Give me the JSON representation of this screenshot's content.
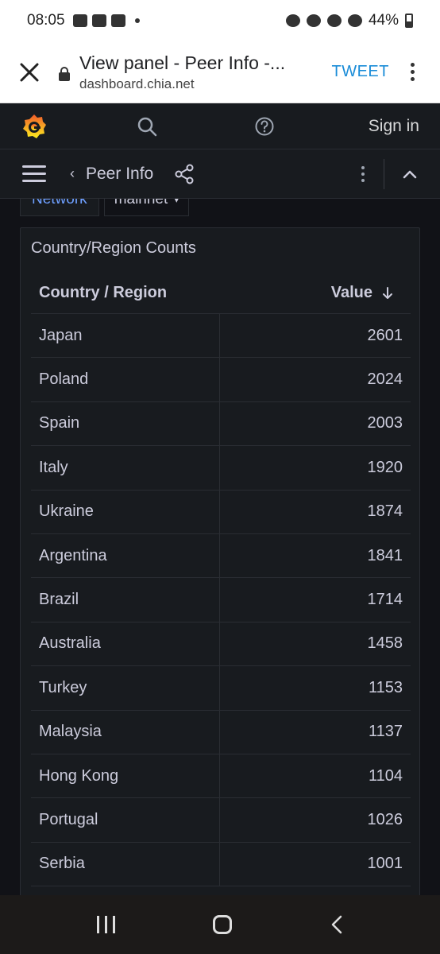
{
  "status_bar": {
    "time": "08:05",
    "battery": "44%"
  },
  "browser": {
    "page_title": "View panel - Peer Info -...",
    "url": "dashboard.chia.net",
    "tweet_label": "TWEET"
  },
  "grafana": {
    "sign_in_label": "Sign in",
    "dashboard_title": "Peer Info",
    "variable": {
      "label": "Network",
      "value": "mainnet"
    }
  },
  "panel": {
    "title": "Country/Region Counts",
    "columns": [
      "Country / Region",
      "Value"
    ],
    "rows": [
      {
        "country": "Japan",
        "value": "2601"
      },
      {
        "country": "Poland",
        "value": "2024"
      },
      {
        "country": "Spain",
        "value": "2003"
      },
      {
        "country": "Italy",
        "value": "1920"
      },
      {
        "country": "Ukraine",
        "value": "1874"
      },
      {
        "country": "Argentina",
        "value": "1841"
      },
      {
        "country": "Brazil",
        "value": "1714"
      },
      {
        "country": "Australia",
        "value": "1458"
      },
      {
        "country": "Turkey",
        "value": "1153"
      },
      {
        "country": "Malaysia",
        "value": "1137"
      },
      {
        "country": "Hong Kong",
        "value": "1104"
      },
      {
        "country": "Portugal",
        "value": "1026"
      },
      {
        "country": "Serbia",
        "value": "1001"
      }
    ]
  },
  "colors": {
    "background": "#111217",
    "panel": "#181b1f",
    "text": "#ccccdc",
    "link": "#1a8cd8",
    "variable_label": "#6e9fff"
  }
}
